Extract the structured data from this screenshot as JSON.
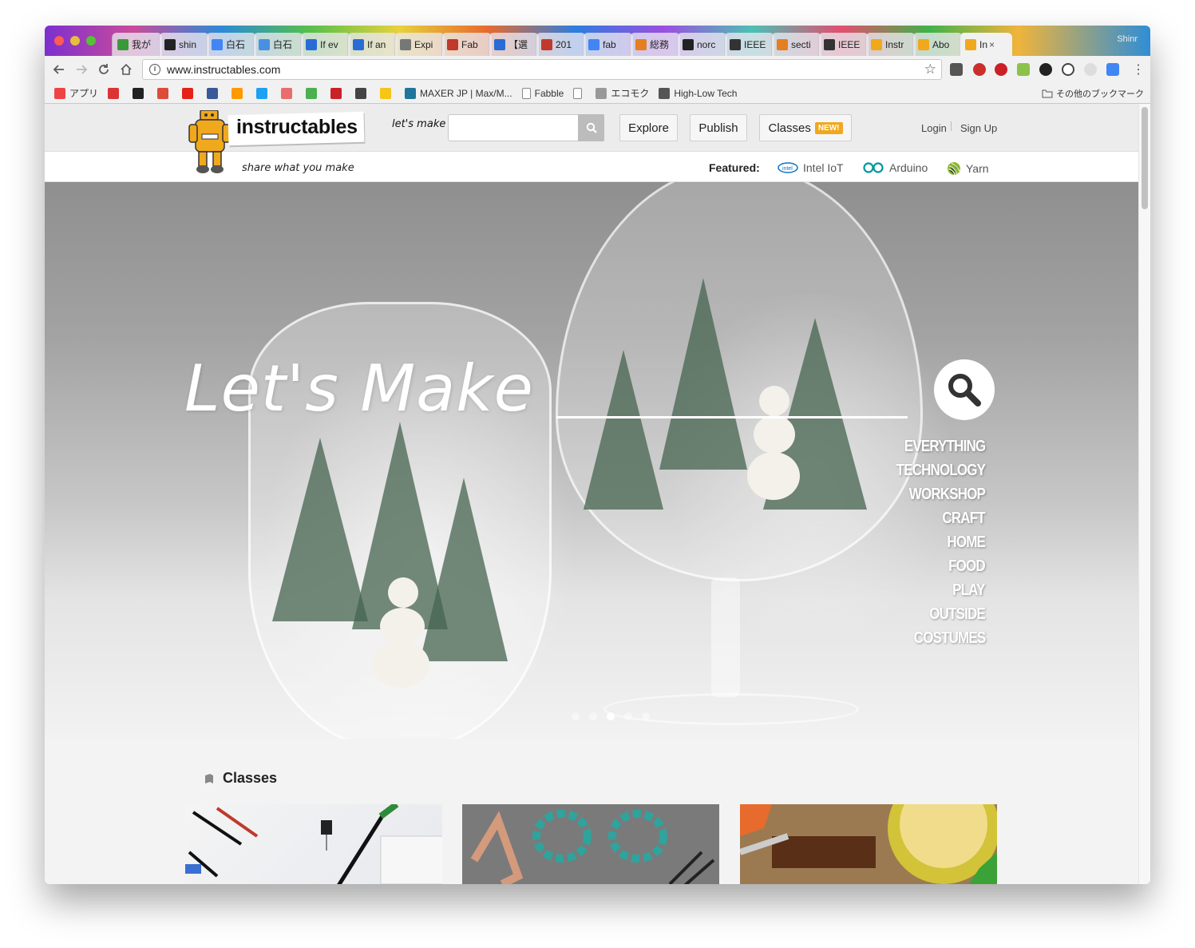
{
  "browser": {
    "tabs": [
      {
        "label": "我が",
        "color": "#3a9a3a"
      },
      {
        "label": "shin",
        "color": "#222222"
      },
      {
        "label": "白石",
        "color": "#4285f4"
      },
      {
        "label": "白石",
        "color": "#4a90e2"
      },
      {
        "label": "If ev",
        "color": "#2a6cd6"
      },
      {
        "label": "If an",
        "color": "#2a6cd6"
      },
      {
        "label": "Expi",
        "color": "#777777"
      },
      {
        "label": "Fab",
        "color": "#c0392b"
      },
      {
        "label": "【選",
        "color": "#2a6cd6"
      },
      {
        "label": "201",
        "color": "#c0392b"
      },
      {
        "label": "fab",
        "color": "#4285f4"
      },
      {
        "label": "総務",
        "color": "#e67e22"
      },
      {
        "label": "norc",
        "color": "#222222"
      },
      {
        "label": "IEEE",
        "color": "#333333"
      },
      {
        "label": "secti",
        "color": "#e67e22"
      },
      {
        "label": "IEEE",
        "color": "#333333"
      },
      {
        "label": "Instr",
        "color": "#f0a81d"
      },
      {
        "label": "Abo",
        "color": "#f0a81d"
      },
      {
        "label": "In",
        "color": "#f0a81d",
        "active": true
      }
    ],
    "close_glyph": "×",
    "profile_label": "Shinr",
    "url": "www.instructables.com",
    "bookmarks": [
      {
        "label": "アプリ",
        "icon": "apps-icon"
      },
      {
        "label": "",
        "icon": "speed-icon"
      },
      {
        "label": "",
        "icon": "tv-icon"
      },
      {
        "label": "",
        "icon": "gplus-icon"
      },
      {
        "label": "",
        "icon": "youtube-icon"
      },
      {
        "label": "",
        "icon": "facebook-icon"
      },
      {
        "label": "",
        "icon": "amazon-icon"
      },
      {
        "label": "",
        "icon": "twitter-icon"
      },
      {
        "label": "",
        "icon": "dots-icon"
      },
      {
        "label": "",
        "icon": "trello-icon"
      },
      {
        "label": "",
        "icon": "pinterest-icon"
      },
      {
        "label": "",
        "icon": "circle-icon"
      },
      {
        "label": "",
        "icon": "note-icon"
      },
      {
        "label": "MAXER JP | Max/M...",
        "icon": "wordpress-icon"
      },
      {
        "label": "Fabble",
        "icon": "doc-icon"
      },
      {
        "label": "",
        "icon": "doc-icon"
      },
      {
        "label": "エコモク",
        "icon": "face-icon"
      },
      {
        "label": "High-Low Tech",
        "icon": "pen-icon"
      }
    ],
    "other_bookmarks": "その他のブックマーク"
  },
  "site": {
    "logo": "instructables",
    "tagline": "share what you make",
    "lets_make_small": "let's make",
    "search_placeholder": "",
    "nav": {
      "explore": "Explore",
      "publish": "Publish",
      "classes": "Classes",
      "new_badge": "NEW!"
    },
    "auth": {
      "login": "Login",
      "signup": "Sign Up"
    },
    "featured_label": "Featured:",
    "featured": [
      {
        "label": "Intel IoT",
        "icon": "intel-icon"
      },
      {
        "label": "Arduino",
        "icon": "arduino-icon"
      },
      {
        "label": "Yarn",
        "icon": "yarn-icon"
      }
    ]
  },
  "hero": {
    "title": "Let's Make",
    "categories": [
      "EVERYTHING",
      "TECHNOLOGY",
      "WORKSHOP",
      "CRAFT",
      "HOME",
      "FOOD",
      "PLAY",
      "OUTSIDE",
      "COSTUMES"
    ],
    "slide_count": 5,
    "active_slide": 3
  },
  "classes_section": {
    "title": "Classes",
    "cards": [
      {
        "name": "electronics-class-card"
      },
      {
        "name": "jewelry-class-card"
      },
      {
        "name": "cooking-class-card"
      }
    ]
  },
  "colors": {
    "brand_orange": "#f0a81d",
    "intel_blue": "#0b71c5",
    "arduino_teal": "#00979c",
    "yarn_green": "#8ab833"
  }
}
